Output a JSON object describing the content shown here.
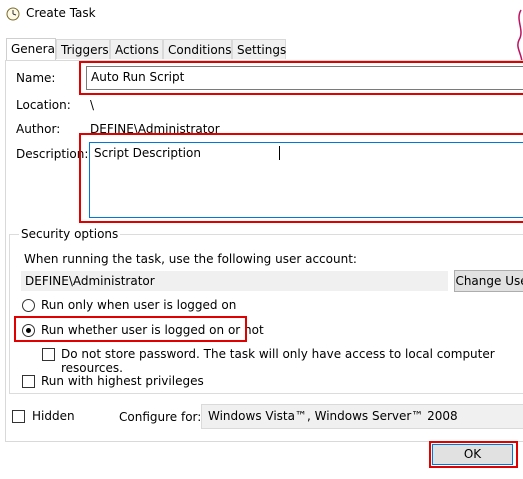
{
  "window": {
    "title": "Create Task"
  },
  "tabs": [
    {
      "label": "General",
      "active": true
    },
    {
      "label": "Triggers",
      "active": false
    },
    {
      "label": "Actions",
      "active": false
    },
    {
      "label": "Conditions",
      "active": false
    },
    {
      "label": "Settings",
      "active": false
    }
  ],
  "general": {
    "name_label": "Name:",
    "name_value": "Auto Run Script",
    "location_label": "Location:",
    "location_value": "\\",
    "author_label": "Author:",
    "author_value": "DEFINE\\Administrator",
    "description_label": "Description:",
    "description_value": "Script Description"
  },
  "security": {
    "legend": "Security options",
    "account_prompt": "When running the task, use the following user account:",
    "account_value": "DEFINE\\Administrator",
    "change_user_label": "Change User",
    "radio_logged_on": "Run only when user is logged on",
    "radio_whether": "Run whether user is logged on or not",
    "selected_radio": "whether",
    "no_store_password": "Do not store password.  The task will only have access to local computer resources.",
    "highest_privileges": "Run with highest privileges"
  },
  "footer": {
    "hidden_label": "Hidden",
    "configure_label": "Configure for:",
    "configure_value": "Windows Vista™, Windows Server™ 2008",
    "ok_label": "OK"
  },
  "colors": {
    "highlight": "#e00000",
    "accent": "#0078d7"
  }
}
